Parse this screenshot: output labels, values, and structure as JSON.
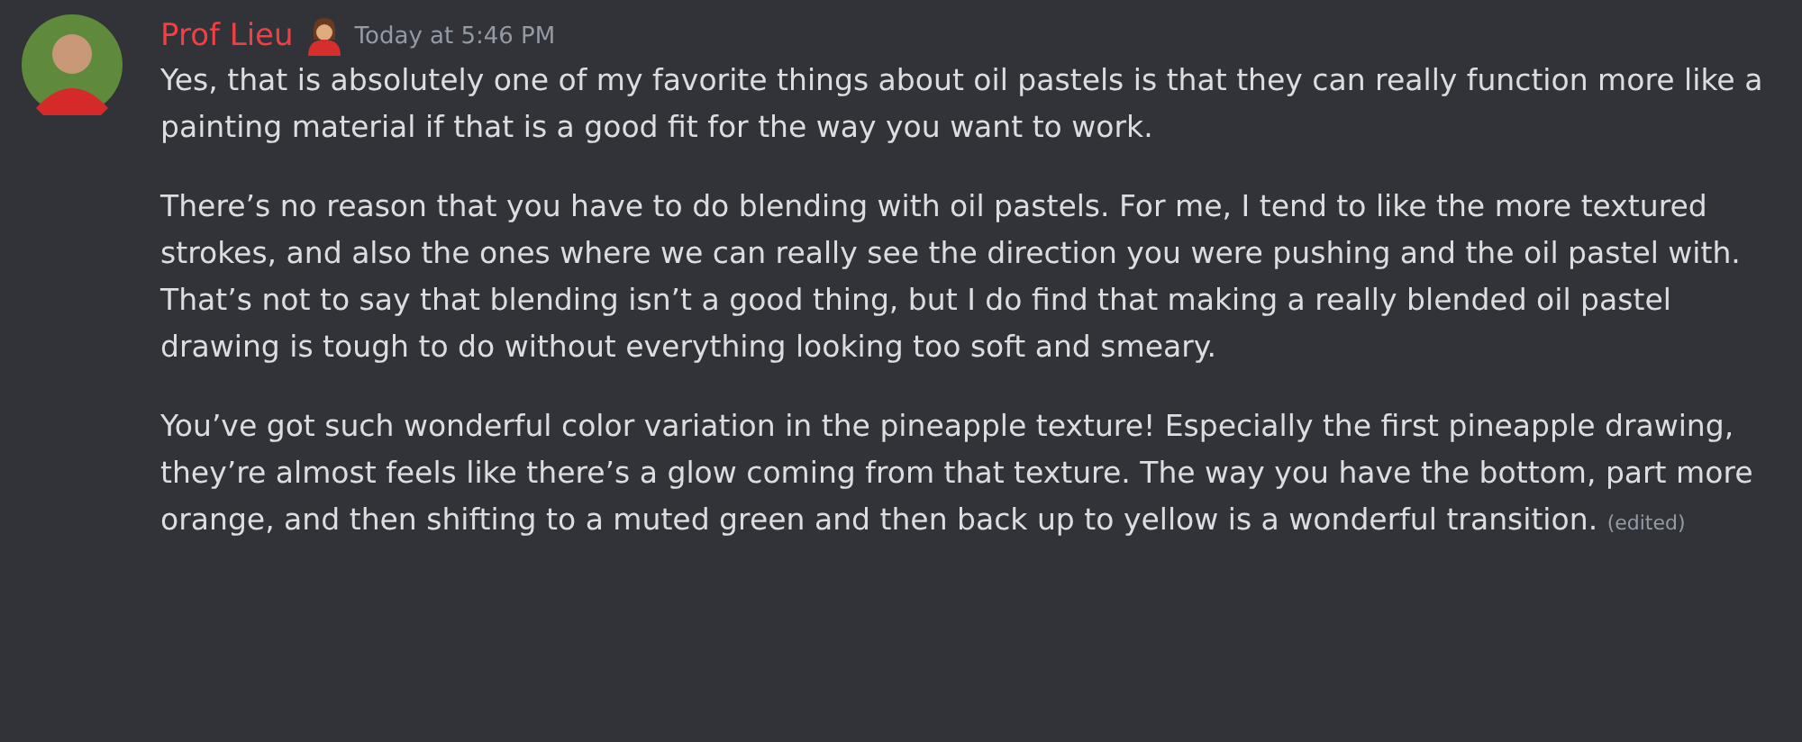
{
  "message": {
    "author": "Prof Lieu",
    "timestamp": "Today at 5:46 PM",
    "paragraphs": [
      "Yes, that is absolutely one of my favorite things about oil pastels is that they can really function more like a painting material if that is a good fit for the way you want to work.",
      "There’s no reason that you have to do blending with oil pastels. For me, I tend to like the more textured strokes, and also the ones where we can really see the direction you were pushing and the oil pastel with. That’s not to say that blending isn’t a good thing, but I do find that making a really blended oil pastel drawing is tough to do without everything looking too soft and smeary.",
      "You’ve got such wonderful color variation in the pineapple texture! Especially the first pineapple drawing, they’re almost feels like there’s a glow coming from that texture. The way you have the bottom, part more orange, and then shifting to a muted green and then back up to yellow is a wonderful transition."
    ],
    "edited_label": "(edited)"
  }
}
